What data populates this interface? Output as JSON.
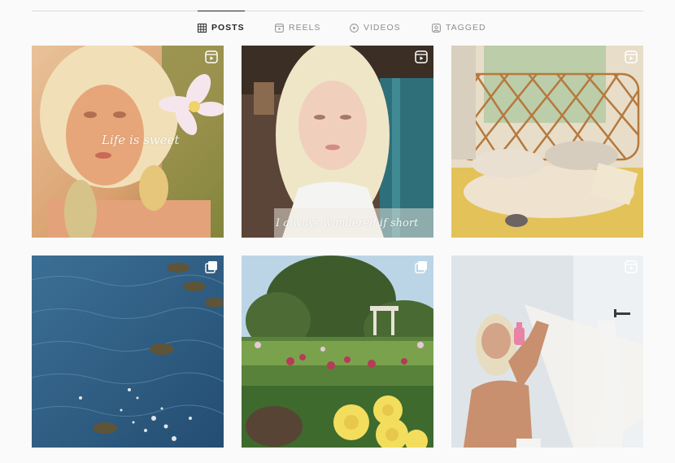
{
  "tabs": [
    {
      "label": "POSTS",
      "icon": "grid-icon",
      "active": true
    },
    {
      "label": "REELS",
      "icon": "reels-icon",
      "active": false
    },
    {
      "label": "VIDEOS",
      "icon": "play-icon",
      "active": false
    },
    {
      "label": "TAGGED",
      "icon": "tag-icon",
      "active": false
    }
  ],
  "posts": [
    {
      "badge": "reel-icon",
      "overlay_text": "Life is sweet"
    },
    {
      "badge": "reel-icon",
      "overlay_text": "I always wondered if short"
    },
    {
      "badge": "reel-icon",
      "overlay_text": ""
    },
    {
      "badge": "carousel-icon",
      "overlay_text": ""
    },
    {
      "badge": "carousel-icon",
      "overlay_text": ""
    },
    {
      "badge": "reel-icon",
      "overlay_text": ""
    }
  ]
}
